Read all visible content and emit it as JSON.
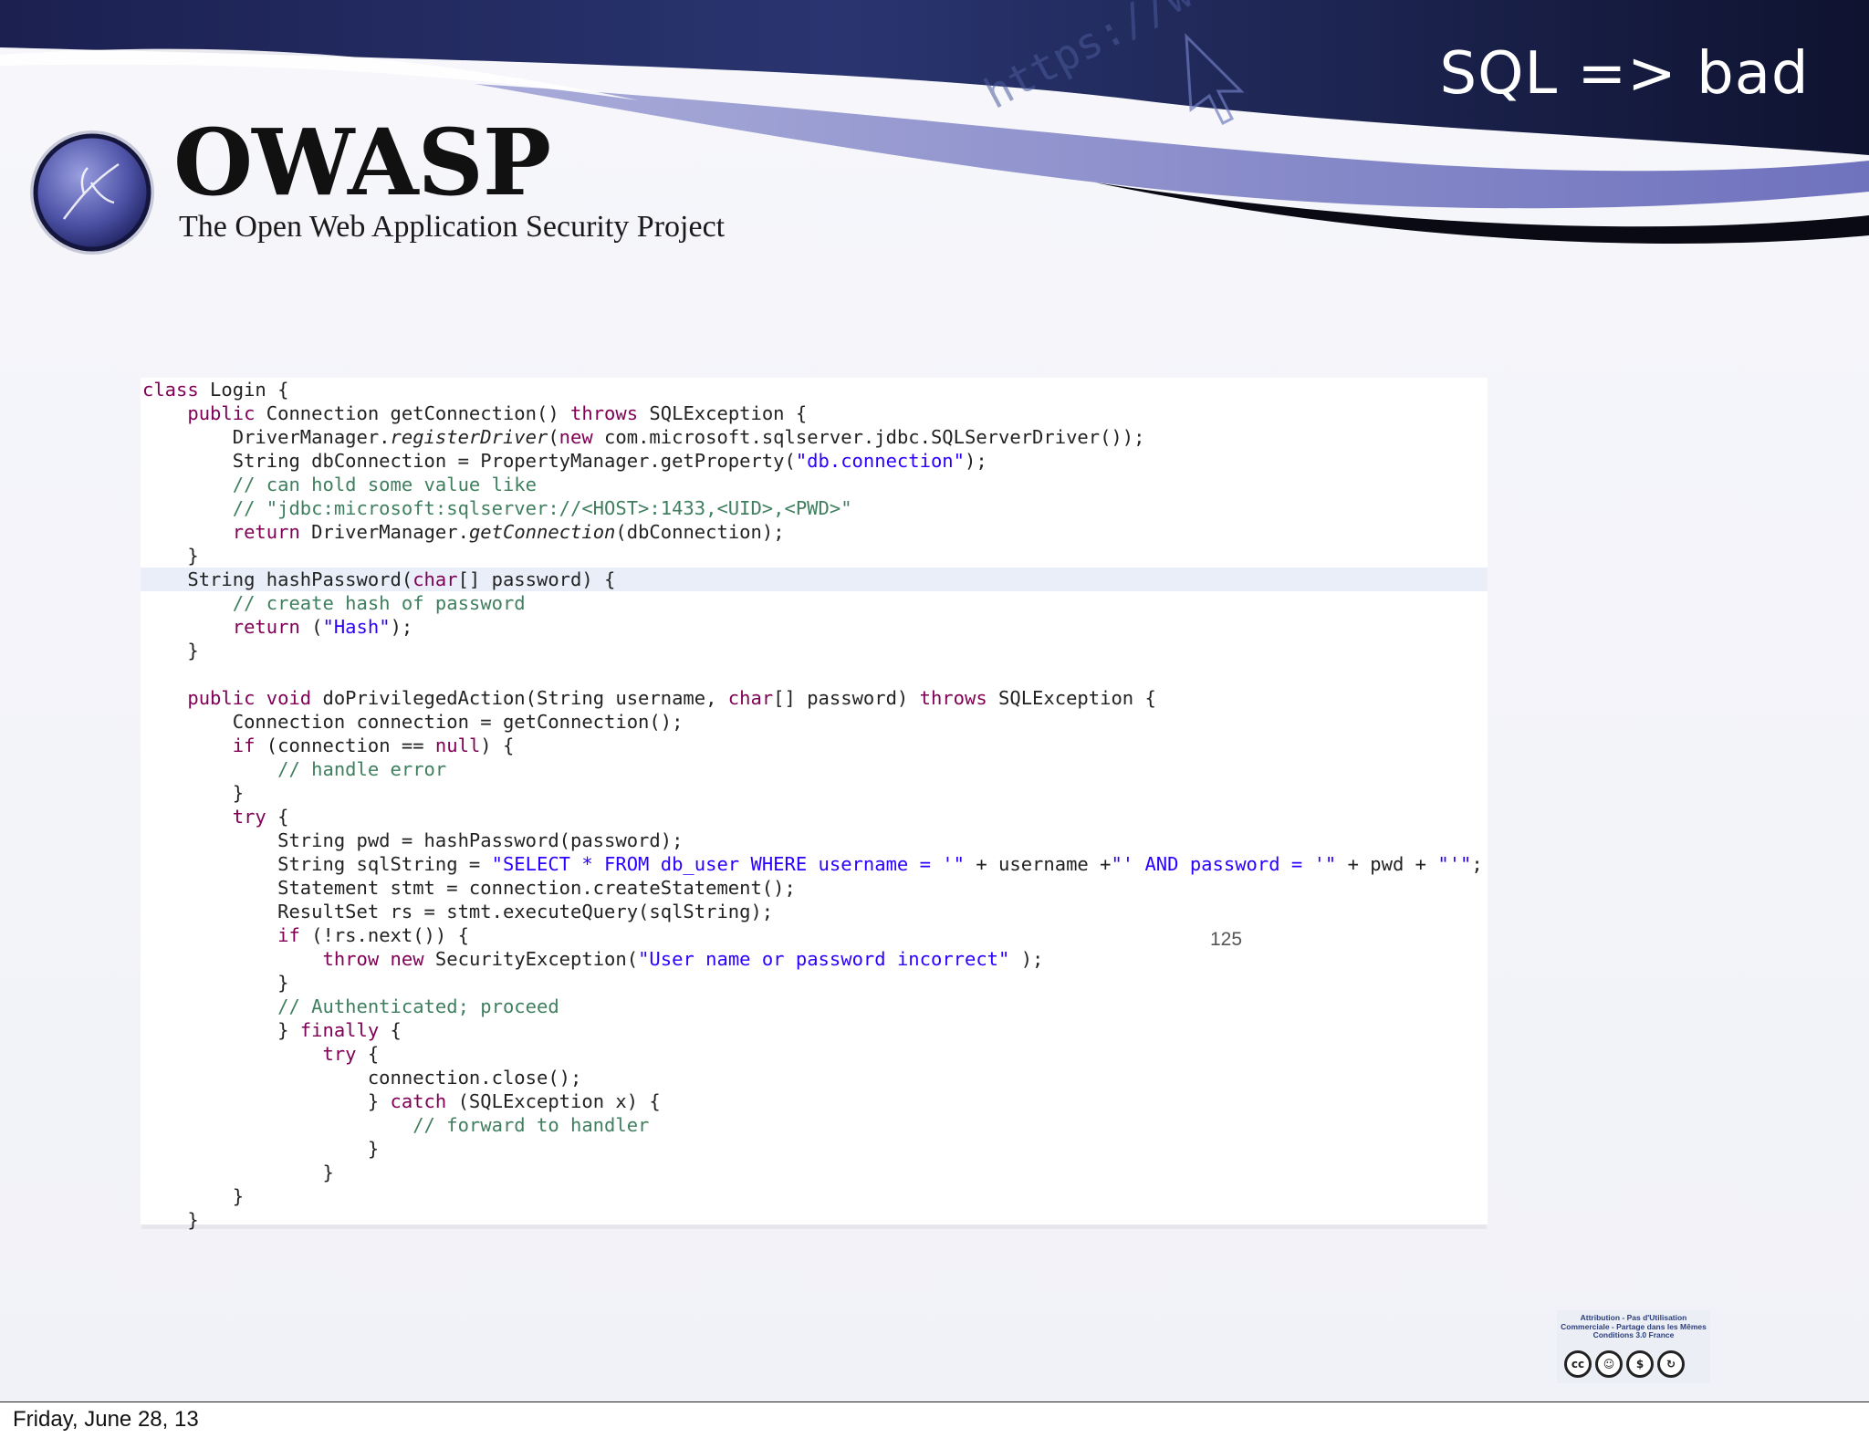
{
  "slide": {
    "title": "SQL => bad",
    "page_number": "125",
    "banner_url_text": "https://www"
  },
  "branding": {
    "name": "OWASP",
    "subtitle": "The Open Web Application Security Project"
  },
  "code": {
    "lines": [
      [
        [
          "kw",
          "class"
        ],
        [
          "t",
          " Login {"
        ]
      ],
      [
        [
          "t",
          "    "
        ],
        [
          "kw",
          "public"
        ],
        [
          "t",
          " Connection getConnection() "
        ],
        [
          "kw",
          "throws"
        ],
        [
          "t",
          " SQLException {"
        ]
      ],
      [
        [
          "t",
          "        DriverManager."
        ],
        [
          "it",
          "registerDriver"
        ],
        [
          "t",
          "("
        ],
        [
          "kw",
          "new"
        ],
        [
          "t",
          " com.microsoft.sqlserver.jdbc.SQLServerDriver());"
        ]
      ],
      [
        [
          "t",
          "        String dbConnection = PropertyManager.getProperty("
        ],
        [
          "str",
          "\"db.connection\""
        ],
        [
          "t",
          ");"
        ]
      ],
      [
        [
          "com",
          "        // can hold some value like"
        ]
      ],
      [
        [
          "com",
          "        // \"jdbc:microsoft:sqlserver://<HOST>:1433,<UID>,<PWD>\""
        ]
      ],
      [
        [
          "t",
          "        "
        ],
        [
          "kw",
          "return"
        ],
        [
          "t",
          " DriverManager."
        ],
        [
          "it",
          "getConnection"
        ],
        [
          "t",
          "(dbConnection);"
        ]
      ],
      [
        [
          "t",
          "    }"
        ]
      ],
      [
        [
          "t",
          "    String hashPassword("
        ],
        [
          "kw",
          "char"
        ],
        [
          "t",
          "[] password) {"
        ]
      ],
      [
        [
          "com",
          "        // create hash of password"
        ]
      ],
      [
        [
          "t",
          "        "
        ],
        [
          "kw",
          "return"
        ],
        [
          "t",
          " ("
        ],
        [
          "str",
          "\"Hash\""
        ],
        [
          "t",
          ");"
        ]
      ],
      [
        [
          "t",
          "    }"
        ]
      ],
      [
        [
          "t",
          ""
        ]
      ],
      [
        [
          "t",
          "    "
        ],
        [
          "kw",
          "public void"
        ],
        [
          "t",
          " doPrivilegedAction(String username, "
        ],
        [
          "kw",
          "char"
        ],
        [
          "t",
          "[] password) "
        ],
        [
          "kw",
          "throws"
        ],
        [
          "t",
          " SQLException {"
        ]
      ],
      [
        [
          "t",
          "        Connection connection = getConnection();"
        ]
      ],
      [
        [
          "t",
          "        "
        ],
        [
          "kw",
          "if"
        ],
        [
          "t",
          " (connection == "
        ],
        [
          "kw",
          "null"
        ],
        [
          "t",
          ") {"
        ]
      ],
      [
        [
          "com",
          "            // handle error"
        ]
      ],
      [
        [
          "t",
          "        }"
        ]
      ],
      [
        [
          "t",
          "        "
        ],
        [
          "kw",
          "try"
        ],
        [
          "t",
          " {"
        ]
      ],
      [
        [
          "t",
          "            String pwd = hashPassword(password);"
        ]
      ],
      [
        [
          "t",
          "            String sqlString = "
        ],
        [
          "str",
          "\"SELECT * FROM db_user WHERE username = '\""
        ],
        [
          "t",
          " + username +"
        ],
        [
          "str",
          "\"' AND password = '\""
        ],
        [
          "t",
          " + pwd + "
        ],
        [
          "str",
          "\"'\""
        ],
        [
          "t",
          ";"
        ]
      ],
      [
        [
          "t",
          "            Statement stmt = connection.createStatement();"
        ]
      ],
      [
        [
          "t",
          "            ResultSet rs = stmt.executeQuery(sqlString);"
        ]
      ],
      [
        [
          "t",
          "            "
        ],
        [
          "kw",
          "if"
        ],
        [
          "t",
          " (!rs.next()) {"
        ]
      ],
      [
        [
          "t",
          "                "
        ],
        [
          "kw",
          "throw new"
        ],
        [
          "t",
          " SecurityException("
        ],
        [
          "str",
          "\"User name or password incorrect\""
        ],
        [
          "t",
          " );"
        ]
      ],
      [
        [
          "t",
          "            }"
        ]
      ],
      [
        [
          "com",
          "            // Authenticated; proceed"
        ]
      ],
      [
        [
          "t",
          "            } "
        ],
        [
          "kw",
          "finally"
        ],
        [
          "t",
          " {"
        ]
      ],
      [
        [
          "t",
          "                "
        ],
        [
          "kw",
          "try"
        ],
        [
          "t",
          " {"
        ]
      ],
      [
        [
          "t",
          "                    connection.close();"
        ]
      ],
      [
        [
          "t",
          "                    } "
        ],
        [
          "kw",
          "catch"
        ],
        [
          "t",
          " (SQLException x) {"
        ]
      ],
      [
        [
          "com",
          "                        // forward to handler"
        ]
      ],
      [
        [
          "t",
          "                    }"
        ]
      ],
      [
        [
          "t",
          "                }"
        ]
      ],
      [
        [
          "t",
          "        }"
        ]
      ],
      [
        [
          "t",
          "    }"
        ]
      ]
    ]
  },
  "license": {
    "text": "Attribution - Pas d'Utilisation Commerciale - Partage dans les Mêmes Conditions 3.0 France",
    "icons": [
      "cc",
      "by",
      "nc",
      "sa"
    ]
  },
  "footer": {
    "date": "Friday, June 28, 13"
  },
  "colors": {
    "banner_dark": "#141a3a",
    "banner_purple": "#7b7fc4",
    "keyword": "#7f0055",
    "string": "#2a00ff",
    "comment": "#3f7f5f"
  }
}
